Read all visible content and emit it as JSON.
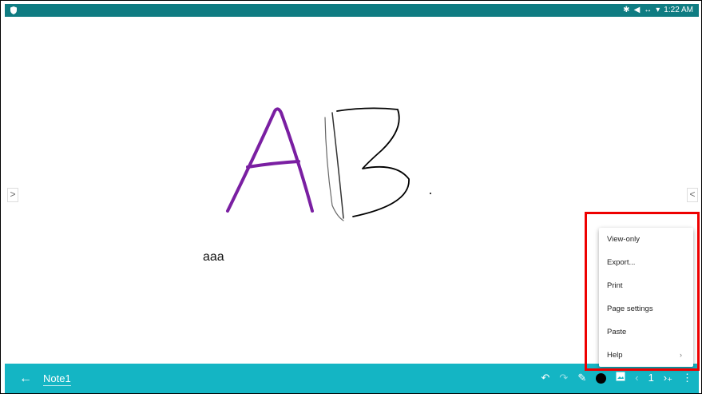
{
  "status_bar": {
    "icons": [
      "bluetooth-icon",
      "volume-icon",
      "data-icon",
      "wifi-icon"
    ],
    "time": "1:22 AM"
  },
  "canvas": {
    "handwriting": [
      "A",
      "B"
    ],
    "typed_text": "aaa",
    "colors": {
      "letter_a": "#7a1fa2",
      "letter_b": "#000000"
    },
    "left_arrow": ">",
    "right_arrow": "<"
  },
  "toolbar": {
    "back_icon": "←",
    "note_title": "Note1",
    "page_number": "1",
    "pen_color": "#000000",
    "background_color": "#14b5c4"
  },
  "menu": {
    "items": [
      "View-only",
      "Export...",
      "Print",
      "Page settings",
      "Paste",
      "Help"
    ],
    "submenu_indicator": "›"
  }
}
